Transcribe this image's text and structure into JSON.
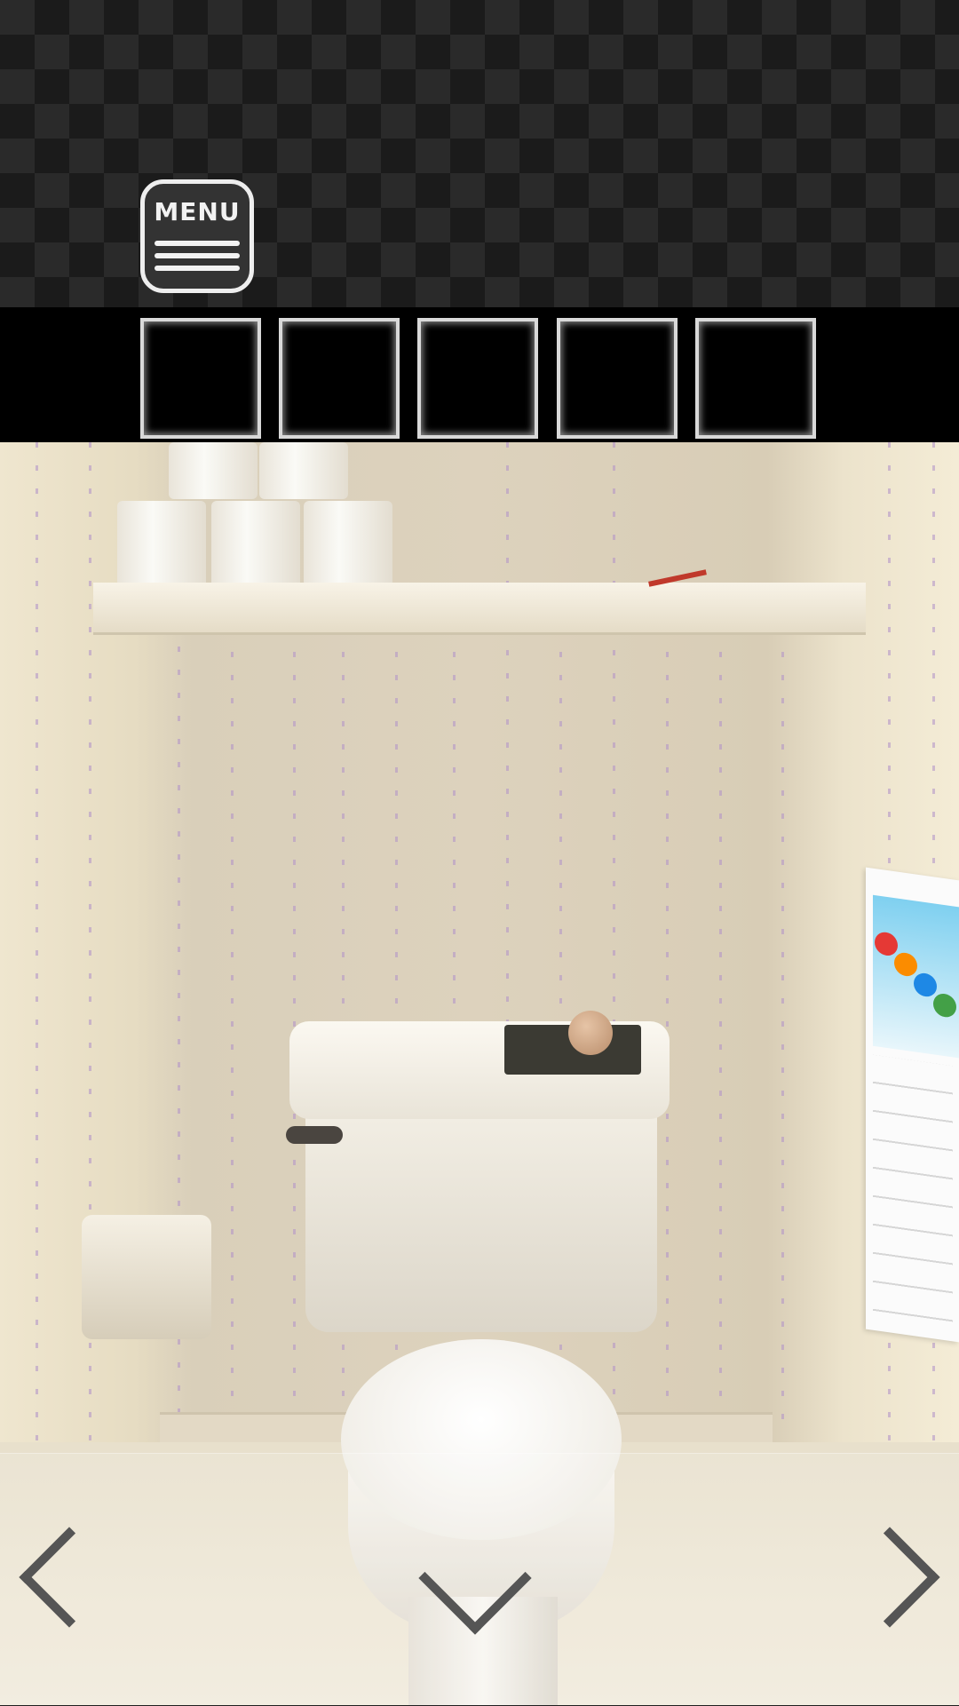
{
  "header": {
    "menu_label": "MENU",
    "menu_icon": "hamburger-menu-icon"
  },
  "inventory": {
    "slots": [
      "",
      "",
      "",
      "",
      ""
    ]
  },
  "scene": {
    "objects": [
      "toilet-paper-rolls",
      "shelf",
      "red-pencil",
      "toilet-tank",
      "ball",
      "toilet-seat",
      "paper-holder",
      "wall-calendar"
    ],
    "colors": {
      "wall": "#e0d6c0",
      "floor": "#efe8d8",
      "toilet": "#f5f2ea",
      "pencil": "#c0392b"
    }
  },
  "navigation": {
    "left_icon": "chevron-left-icon",
    "down_icon": "chevron-down-icon",
    "right_icon": "chevron-right-icon"
  }
}
